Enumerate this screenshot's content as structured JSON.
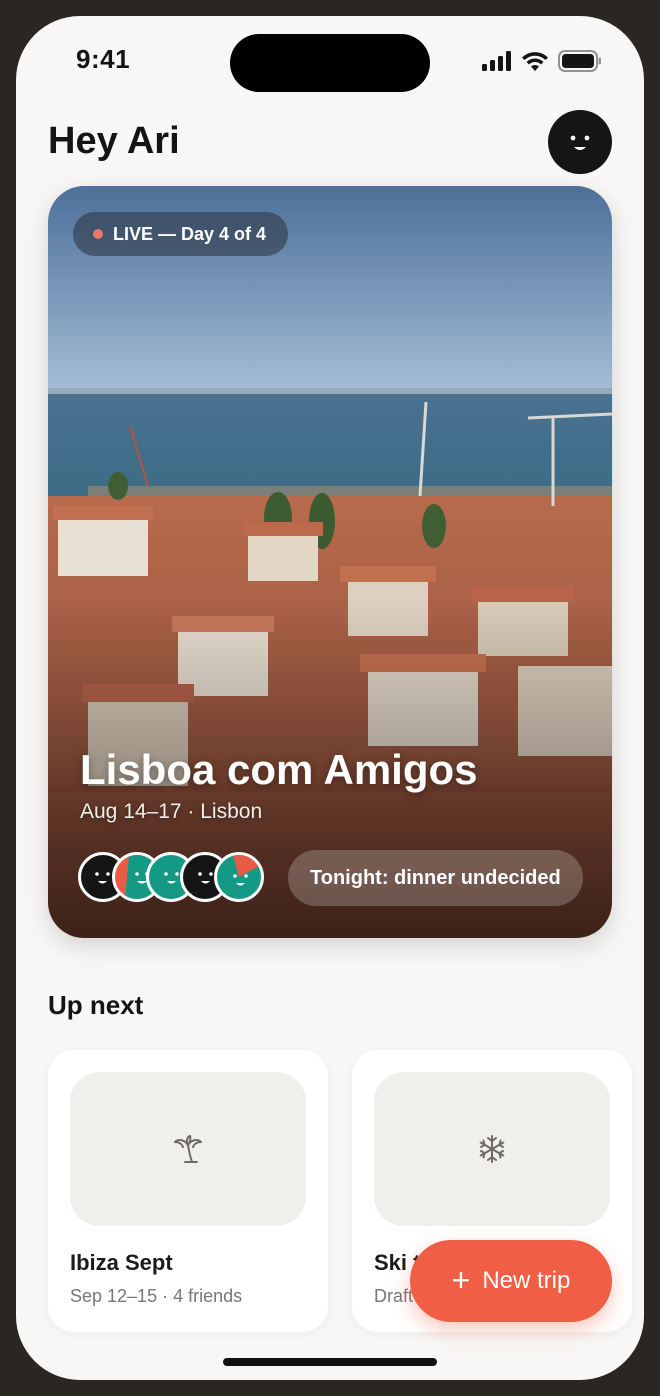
{
  "status_bar": {
    "time": "9:41"
  },
  "header": {
    "greeting": "Hey Ari"
  },
  "hero": {
    "live_badge": "LIVE — Day 4 of 4",
    "title": "Lisboa com Amigos",
    "subtitle": "Aug 14–17 · Lisbon",
    "status_pill": "Tonight: dinner undecided",
    "avatar_colors": [
      "#151515",
      "#e85c45",
      "#149a84",
      "#151515",
      "#149a84"
    ]
  },
  "up_next": {
    "title": "Up next",
    "trips": [
      {
        "name": "Ibiza Sept",
        "meta": "Sep 12–15 · 4 friends",
        "icon": "palm-tree-icon"
      },
      {
        "name": "Ski trip",
        "meta": "Draft",
        "icon": "snowflake-icon"
      }
    ]
  },
  "fab": {
    "label": "New trip"
  },
  "colors": {
    "accent": "#ef5e45",
    "background": "#f8f7f5",
    "teal": "#149a84"
  }
}
